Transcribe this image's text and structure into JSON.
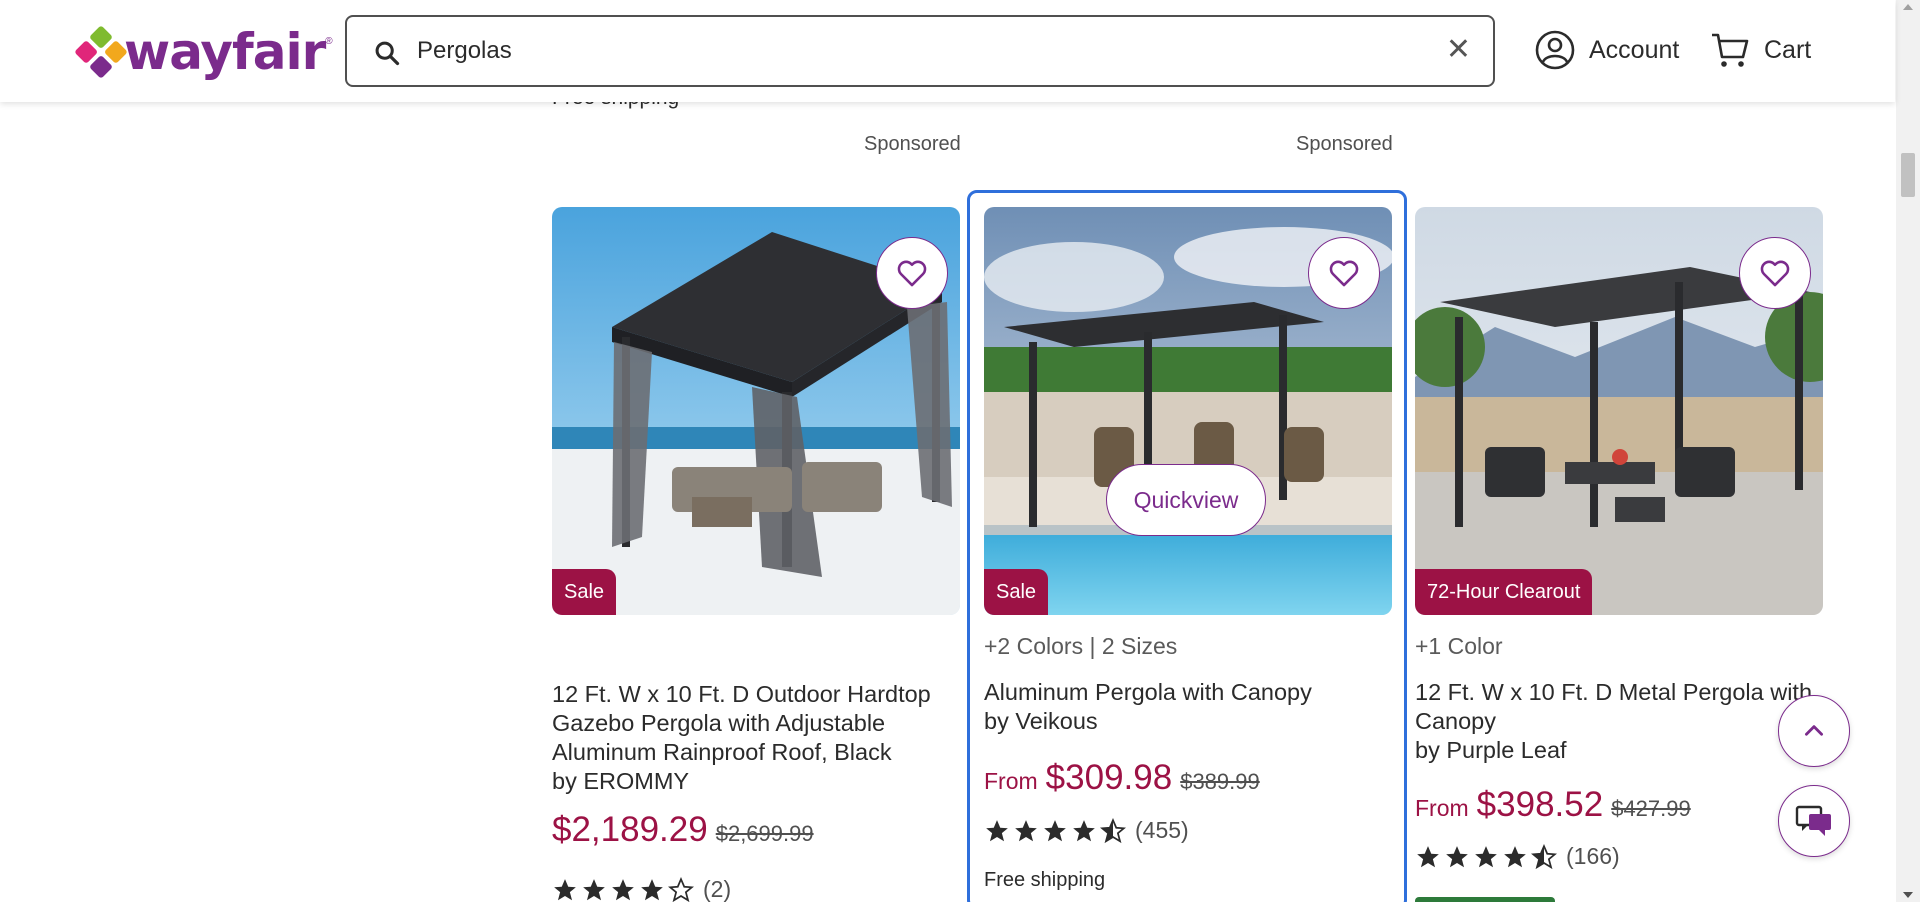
{
  "header": {
    "logo_text": "wayfair",
    "search": {
      "value": "Pergolas"
    },
    "account_label": "Account",
    "cart_label": "Cart"
  },
  "content": {
    "previous_shipping_text": "Free shipping",
    "sponsored_labels": [
      "Sponsored",
      "Sponsored"
    ],
    "quickview_label": "Quickview",
    "products": [
      {
        "badge": "Sale",
        "variants": "",
        "name": "12 Ft. W x 10 Ft. D Outdoor Hardtop Gazebo Pergola with Adjustable Aluminum Rainproof Roof, Black",
        "brand": "by EROMMY",
        "price_prefix": "",
        "price": "$2,189.29",
        "was_price": "$2,699.99",
        "rating": 4,
        "review_count": "(2)",
        "shipping": ""
      },
      {
        "badge": "Sale",
        "variants": "+2 Colors | 2 Sizes",
        "name": "Aluminum Pergola with Canopy",
        "brand": "by Veikous",
        "price_prefix": "From",
        "price": "$309.98",
        "was_price": "$389.99",
        "rating": 4.5,
        "review_count": "(455)",
        "shipping": "Free shipping"
      },
      {
        "badge": "72-Hour Clearout",
        "variants": "+1 Color",
        "name": "12 Ft. W x 10 Ft. D Metal Pergola with Canopy",
        "brand": "by Purple Leaf",
        "price_prefix": "From",
        "price": "$398.52",
        "was_price": "$427.99",
        "rating": 4.5,
        "review_count": "(166)",
        "shipping": ""
      }
    ]
  },
  "colors": {
    "brand_purple": "#7b2b8c",
    "sale_red": "#9c1245",
    "focus_blue": "#2f6fdb"
  },
  "icons": [
    "search-icon",
    "close-icon",
    "account-icon",
    "cart-icon",
    "heart-icon",
    "star-icon",
    "chevron-up-icon",
    "chat-icon"
  ]
}
